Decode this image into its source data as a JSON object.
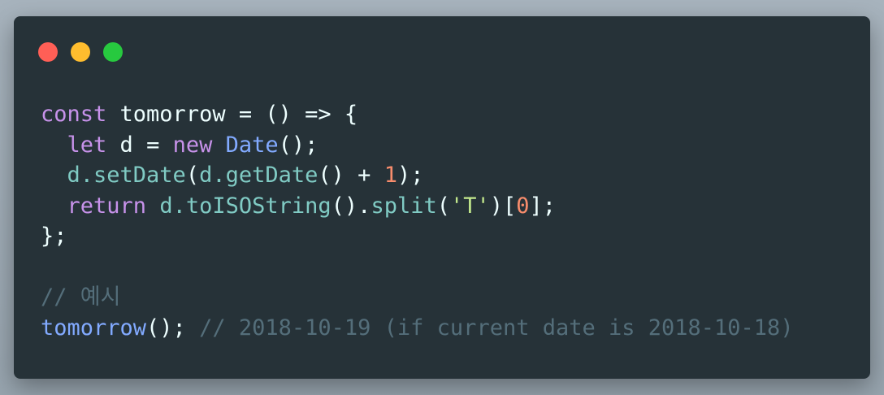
{
  "window": {
    "controls": {
      "close_color": "#ff5f56",
      "minimize_color": "#ffbd2e",
      "zoom_color": "#27c93f"
    }
  },
  "code": {
    "lines": [
      {
        "tokens": [
          {
            "text": "const",
            "type": "keyword"
          },
          {
            "text": " tomorrow = () => {",
            "type": "plain"
          }
        ]
      },
      {
        "tokens": [
          {
            "text": "  ",
            "type": "plain"
          },
          {
            "text": "let",
            "type": "keyword"
          },
          {
            "text": " d = ",
            "type": "plain"
          },
          {
            "text": "new",
            "type": "keyword"
          },
          {
            "text": " ",
            "type": "plain"
          },
          {
            "text": "Date",
            "type": "function"
          },
          {
            "text": "();",
            "type": "plain"
          }
        ]
      },
      {
        "tokens": [
          {
            "text": "  ",
            "type": "plain"
          },
          {
            "text": "d.setDate",
            "type": "property"
          },
          {
            "text": "(",
            "type": "plain"
          },
          {
            "text": "d.getDate",
            "type": "property"
          },
          {
            "text": "() + ",
            "type": "plain"
          },
          {
            "text": "1",
            "type": "number"
          },
          {
            "text": ");",
            "type": "plain"
          }
        ]
      },
      {
        "tokens": [
          {
            "text": "  ",
            "type": "plain"
          },
          {
            "text": "return",
            "type": "keyword"
          },
          {
            "text": " ",
            "type": "plain"
          },
          {
            "text": "d.toISOString",
            "type": "property"
          },
          {
            "text": "().",
            "type": "plain"
          },
          {
            "text": "split",
            "type": "property"
          },
          {
            "text": "(",
            "type": "plain"
          },
          {
            "text": "'T'",
            "type": "string"
          },
          {
            "text": ")[",
            "type": "plain"
          },
          {
            "text": "0",
            "type": "number"
          },
          {
            "text": "];",
            "type": "plain"
          }
        ]
      },
      {
        "tokens": [
          {
            "text": "};",
            "type": "plain"
          }
        ]
      },
      {
        "tokens": []
      },
      {
        "tokens": [
          {
            "text": "// 예시",
            "type": "comment"
          }
        ]
      },
      {
        "tokens": [
          {
            "text": "tomorrow",
            "type": "function"
          },
          {
            "text": "(); ",
            "type": "plain"
          },
          {
            "text": "// 2018-10-19 (if current date is 2018-10-18)",
            "type": "comment"
          }
        ]
      }
    ]
  }
}
